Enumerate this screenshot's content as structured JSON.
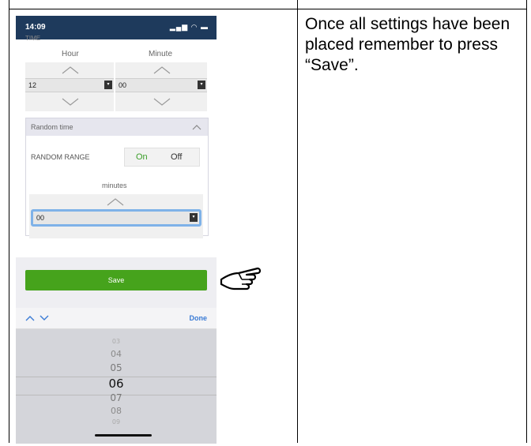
{
  "status_bar": {
    "time": "14:09",
    "icons": "▂▄▆ ◠ ▬"
  },
  "time_section": {
    "label": "TIME",
    "hour_label": "Hour",
    "minute_label": "Minute",
    "hour_value": "12",
    "minute_value": "00"
  },
  "random_panel": {
    "title": "Random time",
    "range_label": "RANDOM RANGE",
    "on_label": "On",
    "off_label": "Off",
    "minutes_label": "minutes",
    "minutes_value": "00"
  },
  "save_label": "Save",
  "keyboard_bar": {
    "done_label": "Done"
  },
  "picker": {
    "items": [
      "03",
      "04",
      "05",
      "06",
      "07",
      "08",
      "09"
    ],
    "selected": "06"
  },
  "instruction": {
    "text": "Once all settings have been placed remember to press “Save”."
  },
  "colors": {
    "accent_green": "#46a31c",
    "status_bar": "#1e3a5c",
    "link_blue": "#3a7bd5"
  },
  "icons": [
    "signal-icon",
    "wifi-icon",
    "battery-icon",
    "chevron-up-icon",
    "chevron-down-icon",
    "pointing-hand-icon"
  ]
}
